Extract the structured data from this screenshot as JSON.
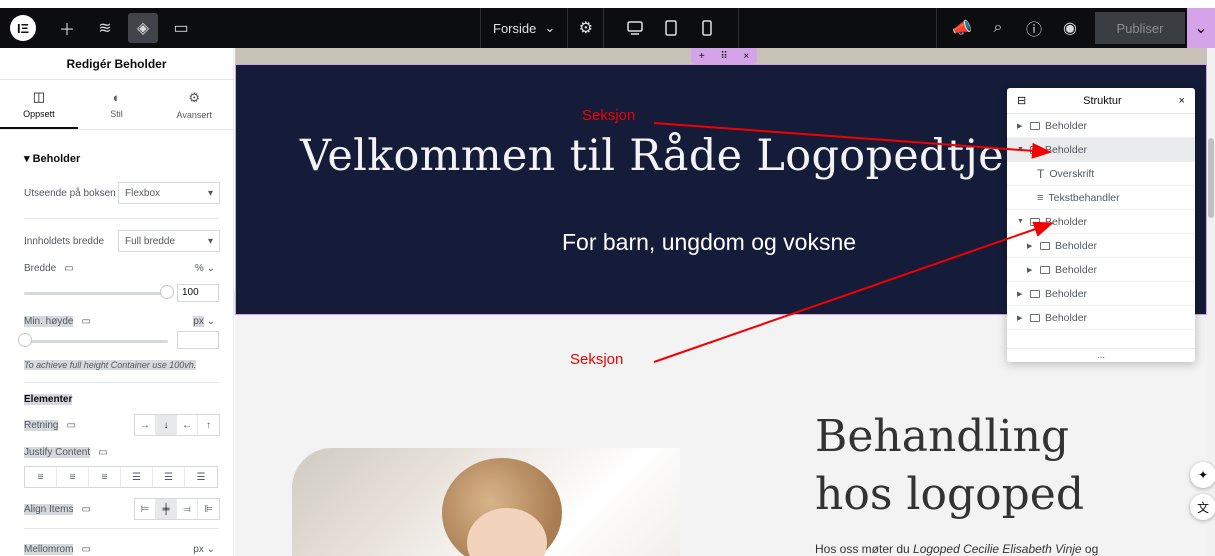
{
  "topbar": {
    "page_name": "Forside",
    "publish_label": "Publiser"
  },
  "panel": {
    "title": "Redigér Beholder",
    "tabs": [
      {
        "label": "Oppsett",
        "icon": "layout-icon"
      },
      {
        "label": "Stil",
        "icon": "half-circle-icon"
      },
      {
        "label": "Avansert",
        "icon": "gear-icon"
      }
    ],
    "section_title": "Beholder",
    "layout_label": "Utseende på boksen",
    "layout_value": "Flexbox",
    "content_width_label": "Innholdets bredde",
    "content_width_value": "Full bredde",
    "width_label": "Bredde",
    "width_unit": "%",
    "width_value": "100",
    "min_height_label": "Min. høyde",
    "min_height_unit": "px",
    "min_height_hint": "To achieve full height Container use 100vh.",
    "elements_label": "Elementer",
    "direction_label": "Retning",
    "justify_label": "Justify Content",
    "align_label": "Align Items",
    "gap_label": "Mellomrom",
    "gap_unit": "px"
  },
  "canvas": {
    "hero_title": "Velkommen til Råde Logopedtje",
    "hero_subtitle": "For barn, ungdom og voksne",
    "behandling_line1": "Behandling",
    "behandling_line2": "hos logoped",
    "behandling_text_pre": "Hos oss møter du ",
    "behandling_text_em": "Logoped Cecilie Elisabeth Vinje",
    "behandling_text_post": " og"
  },
  "structure": {
    "title": "Struktur",
    "items": [
      {
        "label": "Beholder",
        "level": 0,
        "expanded": false
      },
      {
        "label": "Beholder",
        "level": 0,
        "expanded": true,
        "selected": true
      },
      {
        "label": "Overskrift",
        "level": 1,
        "icon": "heading-icon"
      },
      {
        "label": "Tekstbehandler",
        "level": 1,
        "icon": "text-editor-icon"
      },
      {
        "label": "Beholder",
        "level": 0,
        "expanded": true
      },
      {
        "label": "Beholder",
        "level": 1,
        "expanded": false
      },
      {
        "label": "Beholder",
        "level": 1,
        "expanded": false
      },
      {
        "label": "Beholder",
        "level": 0,
        "expanded": false
      },
      {
        "label": "Beholder",
        "level": 0,
        "expanded": false
      }
    ],
    "footer": "..."
  },
  "annotations": {
    "label_1": "Seksjon",
    "label_2": "Seksjon",
    "color": "#f20000"
  }
}
